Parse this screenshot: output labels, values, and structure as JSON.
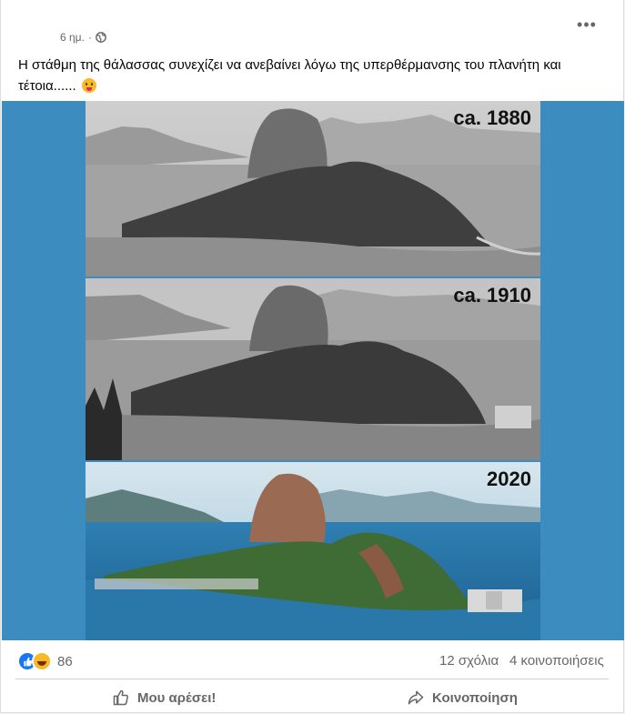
{
  "post": {
    "timestamp": "6 ημ.",
    "separator": "·",
    "text": "Η στάθμη της θάλασσας συνεχίζει να ανεβαίνει λόγω της υπερθέρμανσης του πλανήτη και τέτοια......",
    "emoji": "squinting-tongue-emoji"
  },
  "image": {
    "panels": [
      {
        "year": "ca. 1880",
        "tone": "grayscale"
      },
      {
        "year": "ca. 1910",
        "tone": "grayscale"
      },
      {
        "year": "2020",
        "tone": "color"
      }
    ],
    "background_color": "#3d8cc0"
  },
  "stats": {
    "reaction_count": "86",
    "comments": "12 σχόλια",
    "shares": "4 κοινοποιήσεις"
  },
  "actions": {
    "like_label": "Μου αρέσει!",
    "share_label": "Κοινοποίηση"
  },
  "colors": {
    "accent": "#1877f2",
    "secondary_text": "#65676b"
  }
}
